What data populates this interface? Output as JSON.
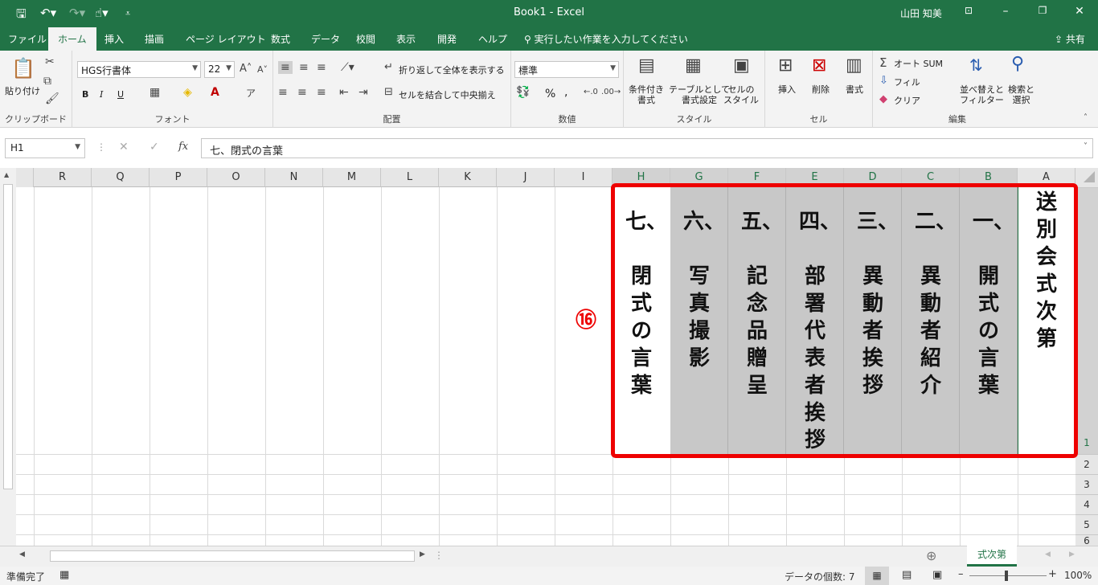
{
  "titlebar": {
    "title": "Book1 - Excel",
    "user": "山田 知美"
  },
  "tabs": [
    {
      "label": "ファイル"
    },
    {
      "label": "ホーム"
    },
    {
      "label": "挿入"
    },
    {
      "label": "描画"
    },
    {
      "label": "ページ レイアウト"
    },
    {
      "label": "数式"
    },
    {
      "label": "データ"
    },
    {
      "label": "校閲"
    },
    {
      "label": "表示"
    },
    {
      "label": "開発"
    },
    {
      "label": "ヘルプ"
    }
  ],
  "tellme": "実行したい作業を入力してください",
  "share": "共有",
  "ribbon": {
    "clipboard": {
      "paste": "貼り付け",
      "label": "クリップボード"
    },
    "font": {
      "name": "HGS行書体",
      "size": "22",
      "label": "フォント",
      "bold": "B",
      "italic": "I",
      "underline": "U"
    },
    "align": {
      "wrap": "折り返して全体を表示する",
      "merge": "セルを結合して中央揃え",
      "label": "配置"
    },
    "number": {
      "format": "標準",
      "label": "数値",
      "percent": "%",
      "comma": ","
    },
    "styles": {
      "conditional": "条件付き\n書式",
      "table": "テーブルとして\n書式設定",
      "cell": "セルの\nスタイル",
      "label": "スタイル"
    },
    "cells": {
      "insert": "挿入",
      "delete": "削除",
      "format": "書式",
      "label": "セル"
    },
    "editing": {
      "autosum": "オート SUM",
      "fill": "フィル",
      "clear": "クリア",
      "sort": "並べ替えと\nフィルター",
      "find": "検索と\n選択",
      "label": "編集"
    }
  },
  "namebox": "H1",
  "formula": "七、閉式の言葉",
  "columns": [
    "R",
    "Q",
    "P",
    "O",
    "N",
    "M",
    "L",
    "K",
    "J",
    "I",
    "H",
    "G",
    "F",
    "E",
    "D",
    "C",
    "B",
    "A"
  ],
  "rows": [
    "1",
    "2",
    "3",
    "4",
    "5",
    "6"
  ],
  "cells": {
    "A": "送別会式次第",
    "B": "一、\n\n開式の言葉",
    "C": "二、\n\n異動者紹介",
    "D": "三、\n\n異動者挨拶",
    "E": "四、\n\n部署代表者挨拶",
    "F": "五、\n\n記念品贈呈",
    "G": "六、\n\n写真撮影",
    "H": "七、\n\n閉式の言葉"
  },
  "marker": "⑯",
  "sheet_tab": "式次第",
  "status": {
    "ready": "準備完了",
    "count": "データの個数: 7",
    "zoom": "100%"
  },
  "colors": {
    "accent": "#217346",
    "highlight": "#ee0000",
    "gray_cell": "#c8c8c8"
  }
}
